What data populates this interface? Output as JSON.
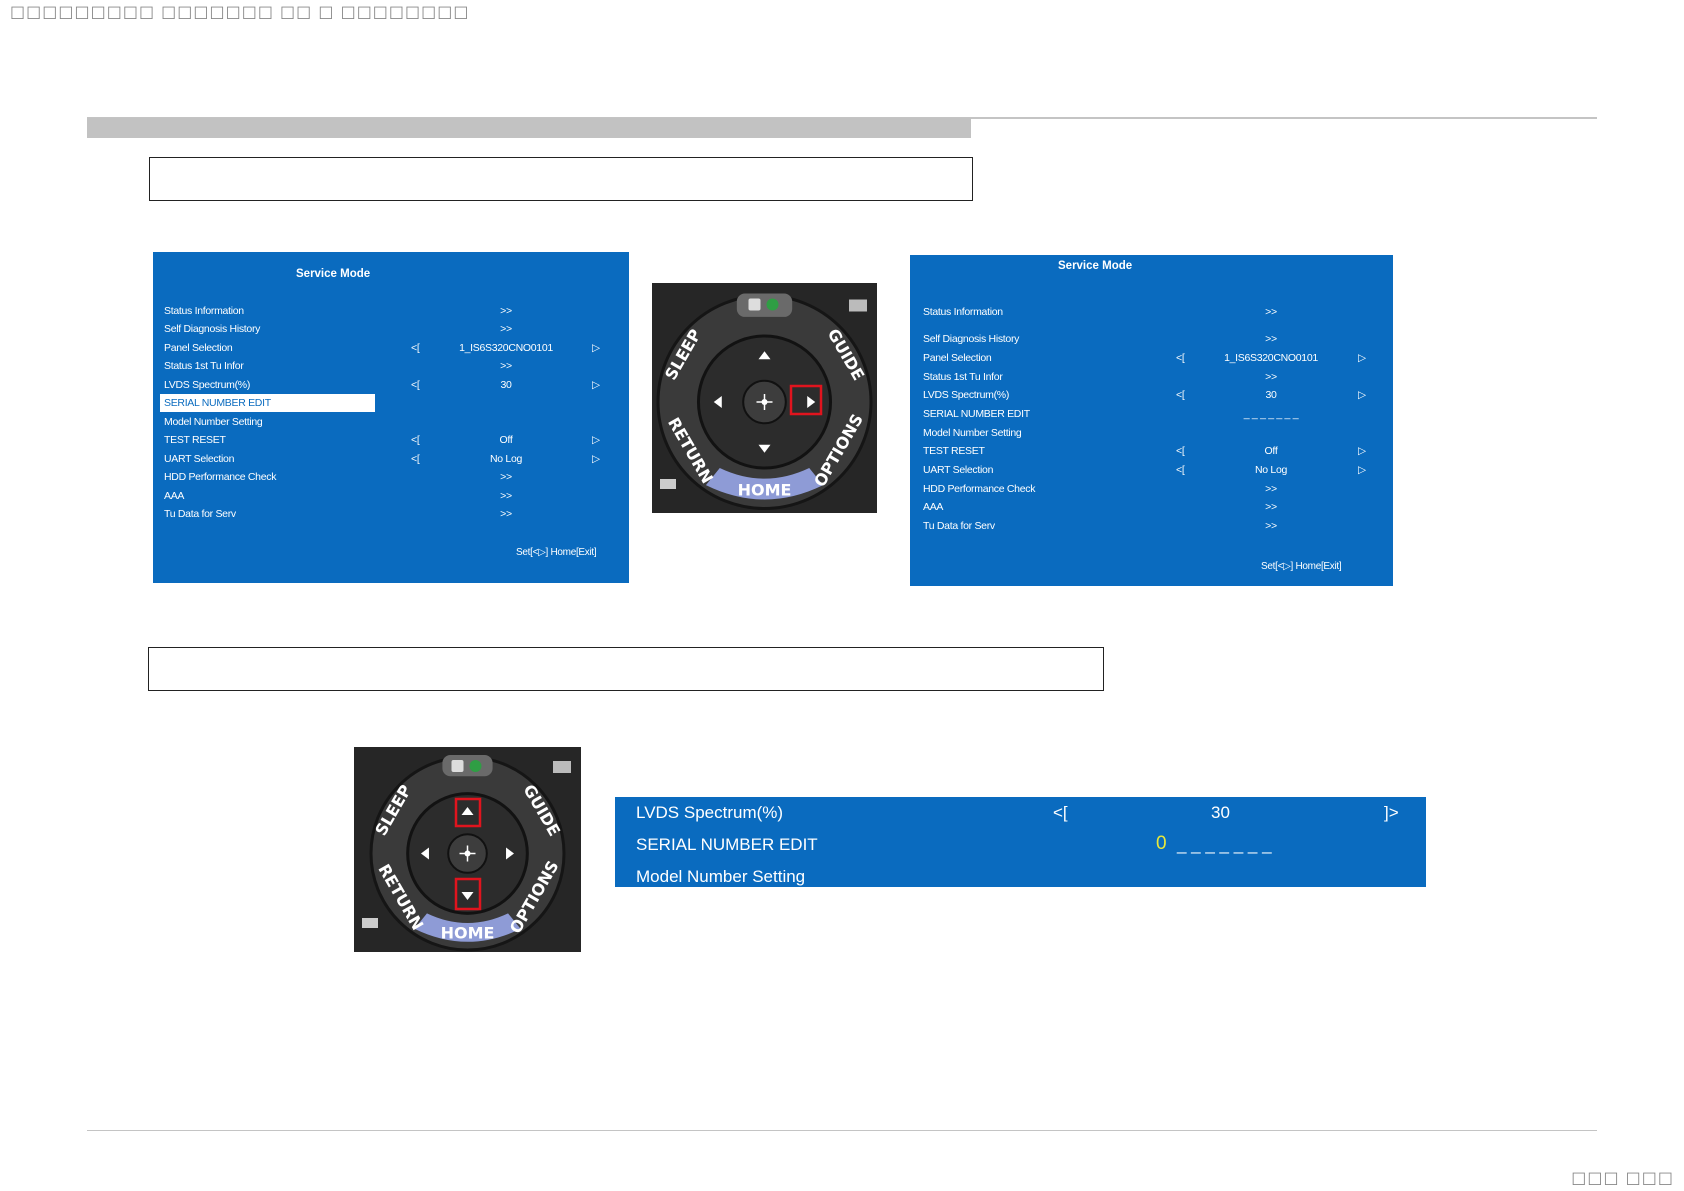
{
  "header": {
    "title_glyphs": "□□□□□□□□□ □□□□□□□ □□ □ □□□□□□□□"
  },
  "footer": {
    "page_glyphs": "□□□ □□□"
  },
  "left_screen": {
    "title": "Service Mode",
    "rows": [
      {
        "label": "Status Information",
        "value": ">>"
      },
      {
        "label": "Self Diagnosis History",
        "value": ">>"
      },
      {
        "label": "Panel Selection",
        "left": "<[",
        "value": "1_IS6S320CNO0101",
        "right": "▷"
      },
      {
        "label": "Status 1st Tu Infor",
        "value": ">>"
      },
      {
        "label": "LVDS Spectrum(%)",
        "left": "<[",
        "value": "30",
        "right": "▷"
      },
      {
        "label": "SERIAL NUMBER EDIT",
        "value": ""
      },
      {
        "label": "Model Number Setting",
        "value": ""
      },
      {
        "label": "TEST RESET",
        "left": "<[",
        "value": "Off",
        "right": "▷"
      },
      {
        "label": "UART Selection",
        "left": "<[",
        "value": "No Log",
        "right": "▷"
      },
      {
        "label": "HDD Performance Check",
        "value": ">>"
      },
      {
        "label": "AAA",
        "value": ">>"
      },
      {
        "label": "Tu Data for Serv",
        "value": ">>"
      }
    ],
    "footer": "Set[<▷] Home[Exit]"
  },
  "right_screen": {
    "title": "Service Mode",
    "rows": [
      {
        "label": "Status Information",
        "value": ">>"
      },
      {
        "label": "Self Diagnosis History",
        "value": ">>"
      },
      {
        "label": "Panel Selection",
        "left": "<[",
        "value": "1_IS6S320CNO0101",
        "right": "▷"
      },
      {
        "label": "Status 1st Tu Infor",
        "value": ">>"
      },
      {
        "label": "LVDS Spectrum(%)",
        "left": "<[",
        "value": "30",
        "right": "▷"
      },
      {
        "label": "SERIAL NUMBER EDIT",
        "value": "_ _ _ _ _ _ _"
      },
      {
        "label": "Model Number Setting",
        "value": ""
      },
      {
        "label": "TEST RESET",
        "left": "<[",
        "value": "Off",
        "right": "▷"
      },
      {
        "label": "UART Selection",
        "left": "<[",
        "value": "No Log",
        "right": "▷"
      },
      {
        "label": "HDD Performance Check",
        "value": ">>"
      },
      {
        "label": "AAA",
        "value": ">>"
      },
      {
        "label": "Tu Data for Serv",
        "value": ">>"
      }
    ],
    "footer": "Set[<▷] Home[Exit]"
  },
  "remote": {
    "sleep": "SLEEP",
    "guide": "GUIDE",
    "return": "RETURN",
    "options": "OPTIONS",
    "home": "HOME"
  },
  "zoom": {
    "row1_label": "LVDS Spectrum(%)",
    "row1_left": "<[",
    "row1_value": "30",
    "row1_right": "]>",
    "row2_label": "SERIAL NUMBER EDIT",
    "row2_digit": "0",
    "row2_rest": "_ _ _ _ _ _ _",
    "row3_label": "Model Number Setting"
  },
  "colors": {
    "screen_blue": "#0a6bbf",
    "highlight_red": "#e0141e",
    "digit_yellow": "#e8e83a"
  }
}
